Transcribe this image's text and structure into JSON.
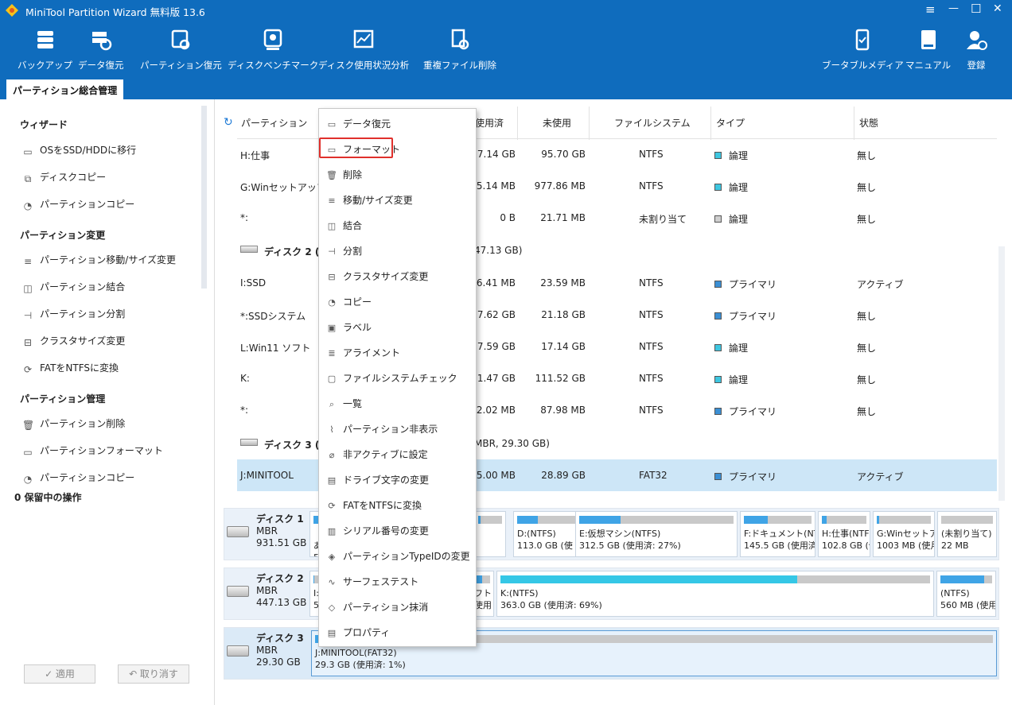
{
  "window": {
    "title": "MiniTool Partition Wizard 無料版 13.6",
    "controls": [
      "≡",
      "—",
      "☐",
      "✕"
    ]
  },
  "toolbar": {
    "items": [
      {
        "label": "バックアップ",
        "icon": "backup-icon"
      },
      {
        "label": "データ復元",
        "icon": "data-recovery-icon"
      },
      {
        "label": "パーティション復元",
        "icon": "partition-recovery-icon"
      },
      {
        "label": "ディスクベンチマーク",
        "icon": "disk-benchmark-icon"
      },
      {
        "label": "ディスク使用状況分析",
        "icon": "space-analyzer-icon"
      },
      {
        "label": "重複ファイル削除",
        "icon": "duplicate-file-icon"
      },
      {
        "label": "ブータブルメディア",
        "icon": "bootable-media-icon"
      },
      {
        "label": "マニュアル",
        "icon": "manual-icon"
      },
      {
        "label": "登録",
        "icon": "register-icon"
      }
    ],
    "tab": "パーティション総合管理"
  },
  "sidebar": {
    "wizard": {
      "title": "ウィザード",
      "items": [
        "OSをSSD/HDDに移行",
        "ディスクコピー",
        "パーティションコピー"
      ]
    },
    "change": {
      "title": "パーティション変更",
      "items": [
        "パーティション移動/サイズ変更",
        "パーティション結合",
        "パーティション分割",
        "クラスタサイズ変更",
        "FATをNTFSに変換"
      ]
    },
    "manage": {
      "title": "パーティション管理",
      "items": [
        "パーティション削除",
        "パーティションフォーマット",
        "パーティションコピー"
      ]
    },
    "pending": "0 保留中の操作",
    "apply": "✓ 適用",
    "undo": "↶ 取り消す"
  },
  "table": {
    "headers": {
      "partition": "パーティション",
      "used": "使用済",
      "unused": "未使用",
      "fs": "ファイルシステム",
      "type": "タイプ",
      "status": "状態"
    },
    "rows": [
      {
        "name": "H:仕事",
        "used": "7.14 GB",
        "unused": "95.70 GB",
        "fs": "NTFS",
        "type": "論理",
        "type_color": "#3ec6e0",
        "status": "無し"
      },
      {
        "name": "G:Winセットアップ",
        "used": "25.14 MB",
        "unused": "977.86 MB",
        "fs": "NTFS",
        "type": "論理",
        "type_color": "#3ec6e0",
        "status": "無し"
      },
      {
        "name": "*:",
        "used": "0 B",
        "unused": "21.71 MB",
        "fs": "未割り当て",
        "type": "論理",
        "type_color": "#cfcfcf",
        "status": "無し"
      },
      {
        "disk": true,
        "name": "ディスク 2 (KI",
        "rest": "47.13 GB)"
      },
      {
        "name": "I:SSD",
        "used": "26.41 MB",
        "unused": "23.59 MB",
        "fs": "NTFS",
        "type": "プライマリ",
        "type_color": "#3b8fd4",
        "status": "アクティブ"
      },
      {
        "name": "*:SSDシステム",
        "used": "27.62 GB",
        "unused": "21.18 GB",
        "fs": "NTFS",
        "type": "プライマリ",
        "type_color": "#3b8fd4",
        "status": "無し"
      },
      {
        "name": "L:Win11 ソフト",
        "used": "17.59 GB",
        "unused": "17.14 GB",
        "fs": "NTFS",
        "type": "論理",
        "type_color": "#3ec6e0",
        "status": "無し"
      },
      {
        "name": "K:",
        "used": "251.47 GB",
        "unused": "111.52 GB",
        "fs": "NTFS",
        "type": "論理",
        "type_color": "#3ec6e0",
        "status": "無し"
      },
      {
        "name": "*:",
        "used": "472.02 MB",
        "unused": "87.98 MB",
        "fs": "NTFS",
        "type": "プライマリ",
        "type_color": "#3b8fd4",
        "status": "無し"
      },
      {
        "disk": true,
        "name": "ディスク 3 (Ve",
        "rest": "MBR, 29.30 GB)"
      },
      {
        "name": "J:MINITOOL",
        "used": "415.00 MB",
        "unused": "28.89 GB",
        "fs": "FAT32",
        "type": "プライマリ",
        "type_color": "#3b8fd4",
        "status": "アクティブ",
        "selected": true
      }
    ]
  },
  "disks": [
    {
      "name": "ディスク 1",
      "scheme": "MBR",
      "size": "931.51 GB",
      "parts": [
        {
          "l1": "",
          "l2": "あ",
          "l3": "5",
          "pct": 5
        },
        {
          "l1": "",
          "l2": "",
          "l3": "",
          "pct": 10
        },
        {
          "l1": "D:(NTFS)",
          "l2": "113.0 GB (使",
          "pct": 35
        },
        {
          "l1": "E:仮想マシン(NTFS)",
          "l2": "312.5 GB (使用済: 27%)",
          "pct": 27
        },
        {
          "l1": "F:ドキュメント(NTF",
          "l2": "145.5 GB (使用済",
          "pct": 35
        },
        {
          "l1": "H:仕事(NTFS)",
          "l2": "102.8 GB (使",
          "pct": 10
        },
        {
          "l1": "G:Winセットアップ",
          "l2": "1003 MB (使月",
          "pct": 5
        },
        {
          "l1": "(未割り当て)",
          "l2": "22 MB",
          "pct": 0
        }
      ]
    },
    {
      "name": "ディスク 2",
      "scheme": "MBR",
      "size": "447.13 GB",
      "parts": [
        {
          "l1": "I:",
          "l2": "5",
          "pct": 5
        },
        {
          "l1": "フト",
          "l2": "使用",
          "pct": 50
        },
        {
          "l1": "K:(NTFS)",
          "l2": "363.0 GB (使用済: 69%)",
          "pct": 69
        },
        {
          "l1": "(NTFS)",
          "l2": "560 MB (使用",
          "pct": 84
        }
      ]
    },
    {
      "name": "ディスク 3",
      "scheme": "MBR",
      "size": "29.30 GB",
      "parts": [
        {
          "l1": "J:MINITOOL(FAT32)",
          "l2": "29.3 GB (使用済: 1%)",
          "pct": 1
        }
      ]
    }
  ],
  "context_menu": {
    "items": [
      {
        "label": "データ復元",
        "icon": "data-recovery-icon"
      },
      {
        "label": "フォーマット",
        "icon": "format-icon",
        "highlighted": true
      },
      {
        "label": "削除",
        "icon": "trash-icon"
      },
      {
        "label": "移動/サイズ変更",
        "icon": "move-resize-icon"
      },
      {
        "label": "結合",
        "icon": "merge-icon"
      },
      {
        "label": "分割",
        "icon": "split-icon"
      },
      {
        "label": "クラスタサイズ変更",
        "icon": "cluster-size-icon"
      },
      {
        "label": "コピー",
        "icon": "copy-icon"
      },
      {
        "label": "ラベル",
        "icon": "label-icon"
      },
      {
        "label": "アライメント",
        "icon": "align-icon"
      },
      {
        "label": "ファイルシステムチェック",
        "icon": "fs-check-icon"
      },
      {
        "label": "一覧",
        "icon": "explore-icon"
      },
      {
        "label": "パーティション非表示",
        "icon": "hide-icon"
      },
      {
        "label": "非アクティブに設定",
        "icon": "inactive-icon"
      },
      {
        "label": "ドライブ文字の変更",
        "icon": "drive-letter-icon"
      },
      {
        "label": "FATをNTFSに変換",
        "icon": "convert-icon"
      },
      {
        "label": "シリアル番号の変更",
        "icon": "serial-icon"
      },
      {
        "label": "パーティションTypeIDの変更",
        "icon": "typeid-icon"
      },
      {
        "label": "サーフェステスト",
        "icon": "surface-test-icon"
      },
      {
        "label": "パーティション抹消",
        "icon": "wipe-icon"
      },
      {
        "label": "プロパティ",
        "icon": "properties-icon"
      }
    ]
  }
}
